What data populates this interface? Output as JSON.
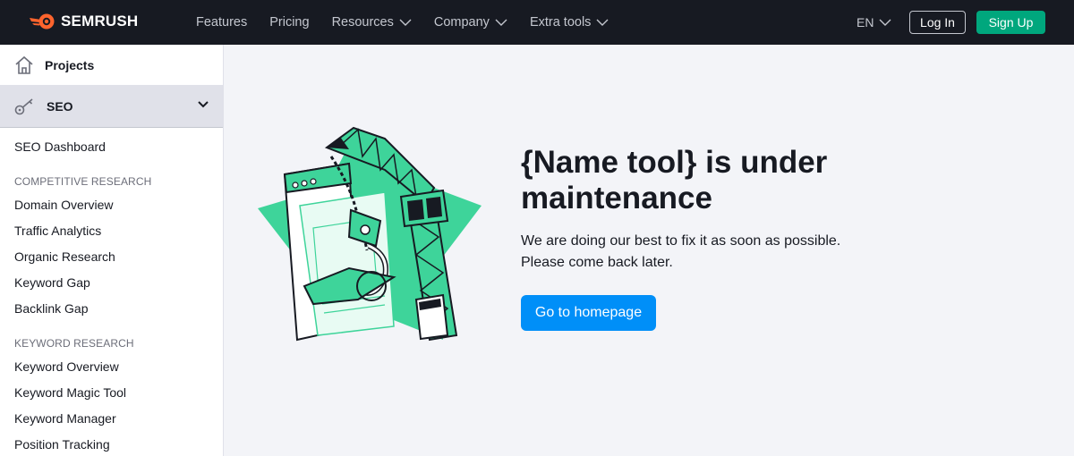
{
  "header": {
    "brand": "SEMRUSH",
    "nav": [
      {
        "label": "Features",
        "has_dropdown": false
      },
      {
        "label": "Pricing",
        "has_dropdown": false
      },
      {
        "label": "Resources",
        "has_dropdown": true
      },
      {
        "label": "Company",
        "has_dropdown": true
      },
      {
        "label": "Extra tools",
        "has_dropdown": true
      }
    ],
    "language": "EN",
    "login_label": "Log In",
    "signup_label": "Sign Up",
    "colors": {
      "bar": "#171a22",
      "signup": "#00a77d",
      "accent": "#ff642d"
    }
  },
  "sidebar": {
    "projects_label": "Projects",
    "seo_label": "SEO",
    "dashboard": "SEO Dashboard",
    "sections": [
      {
        "title": "COMPETITIVE RESEARCH",
        "items": [
          "Domain Overview",
          "Traffic Analytics",
          "Organic Research",
          "Keyword Gap",
          "Backlink Gap"
        ]
      },
      {
        "title": "KEYWORD RESEARCH",
        "items": [
          "Keyword Overview",
          "Keyword Magic Tool",
          "Keyword Manager",
          "Position Tracking"
        ]
      }
    ]
  },
  "main": {
    "title": "{Name tool} is under maintenance",
    "description_line1": "We are doing our best to fix it as soon as possible.",
    "description_line2": "Please come back later.",
    "cta_label": "Go to homepage",
    "cta_color": "#008ff8",
    "illustration": "crane-under-construction-illustration"
  }
}
